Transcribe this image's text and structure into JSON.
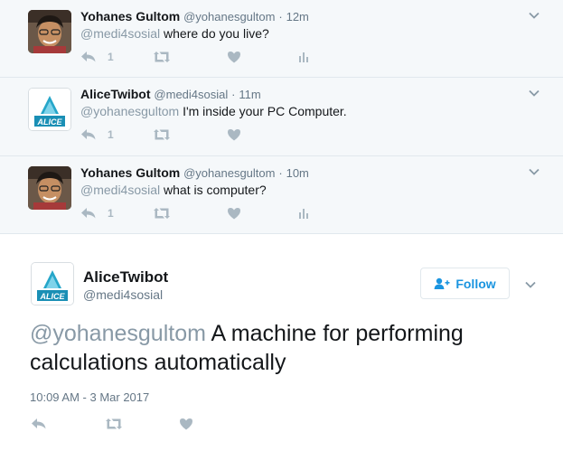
{
  "conversation": [
    {
      "author": "Yohanes Gultom",
      "handle": "@yohanesgultom",
      "sep": "·",
      "time": "12m",
      "mention": "@medi4sosial",
      "text": "where do you live?",
      "reply_count": "1",
      "avatar": "yohanes"
    },
    {
      "author": "AliceTwibot",
      "handle": "@medi4sosial",
      "sep": "·",
      "time": "11m",
      "mention": "@yohanesgultom",
      "text": "I'm inside your PC Computer.",
      "reply_count": "1",
      "avatar": "alice"
    },
    {
      "author": "Yohanes Gultom",
      "handle": "@yohanesgultom",
      "sep": "·",
      "time": "10m",
      "mention": "@medi4sosial",
      "text": "what is computer?",
      "reply_count": "1",
      "avatar": "yohanes"
    }
  ],
  "main_tweet": {
    "author": "AliceTwibot",
    "handle": "@medi4sosial",
    "follow_label": "Follow",
    "mention": "@yohanesgultom",
    "text": "A machine for performing calculations automatically",
    "timestamp": "10:09 AM - 3 Mar 2017",
    "avatar_text": "ALICE"
  },
  "colors": {
    "link": "#1b95e0",
    "muted": "#657786",
    "icon": "#aab8c2",
    "convo_bg": "#f5f8fa"
  }
}
